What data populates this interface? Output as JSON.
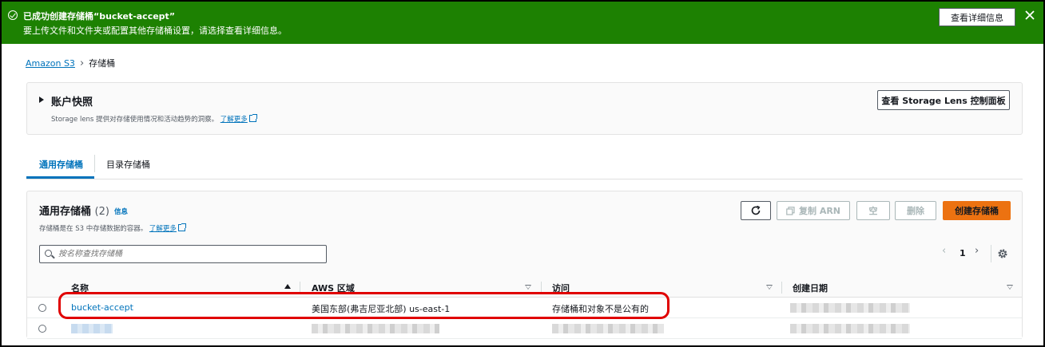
{
  "flash": {
    "title": "已成功创建存储桶“bucket-accept”",
    "subtitle": "要上传文件和文件夹或配置其他存储桶设置，请选择查看详细信息。",
    "button_label": "查看详细信息",
    "color": "#1d8102"
  },
  "breadcrumb": {
    "root": "Amazon S3",
    "current": "存储桶"
  },
  "account_snapshot": {
    "title": "账户快照",
    "description": "Storage lens 提供对存储使用情况和活动趋势的洞察。",
    "learn_more": "了解更多",
    "button_label": "查看 Storage Lens 控制面板"
  },
  "tabs": [
    {
      "label": "通用存储桶",
      "active": true
    },
    {
      "label": "目录存储桶",
      "active": false
    }
  ],
  "buckets_panel": {
    "title": "通用存储桶",
    "count": "(2)",
    "info": "信息",
    "description": "存储桶是在 S3 中存储数据的容器。",
    "learn_more": "了解更多",
    "buttons": {
      "copy_arn": "复制 ARN",
      "empty": "空",
      "delete": "删除",
      "create": "创建存储桶"
    },
    "search_placeholder": "按名称查找存储桶",
    "page": "1",
    "accent": "#ec7211"
  },
  "table": {
    "columns": [
      "名称",
      "AWS 区域",
      "访问",
      "创建日期"
    ],
    "rows": [
      {
        "name": "bucket-accept",
        "region": "美国东部(弗吉尼亚北部) us-east-1",
        "access": "存储桶和对象不是公有的",
        "created": ""
      },
      {
        "name": "",
        "region": "",
        "access": "",
        "created": ""
      }
    ]
  }
}
